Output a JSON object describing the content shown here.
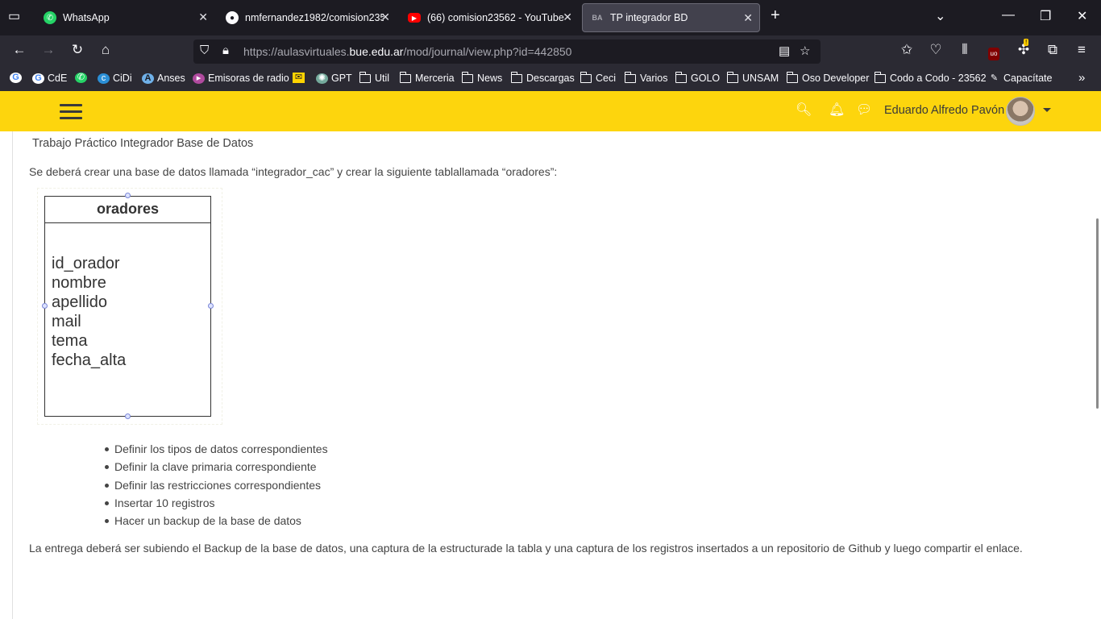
{
  "browser": {
    "tabs": [
      {
        "title": "WhatsApp",
        "icon": "whatsapp-icon"
      },
      {
        "title": "nmfernandez1982/comision235",
        "icon": "github-icon"
      },
      {
        "title": "(66) comision23562 - YouTube",
        "icon": "youtube-icon"
      },
      {
        "title": "TP integrador BD",
        "icon": "ba-icon"
      }
    ],
    "url_prefix": "https://aulasvirtuales.",
    "url_domain": "bue.edu.ar",
    "url_path": "/mod/journal/view.php?id=442850",
    "bookmarks": [
      "CdE",
      "CiDi",
      "Anses",
      "Emisoras de radio",
      "GPT",
      "Util",
      "Merceria",
      "News",
      "Descargas",
      "Ceci",
      "Varios",
      "GOLO",
      "UNSAM",
      "Oso Developer",
      "Codo a Codo - 23562",
      "Capacítate"
    ],
    "extension_badge": "!"
  },
  "header": {
    "user_name": "Eduardo Alfredo Pavón",
    "accent_color": "#fdd50d"
  },
  "page": {
    "heading": "Trabajo Práctico Integrador Base de Datos",
    "intro": "Se deberá crear una base de datos llamada “integrador_cac” y crear la siguiente tablallamada “oradores”:",
    "entity": {
      "name": "oradores",
      "fields": [
        "id_orador",
        "nombre",
        "apellido",
        "mail",
        "tema",
        "fecha_alta"
      ]
    },
    "tasks": [
      "Definir los tipos de datos correspondientes",
      "Definir la clave primaria correspondiente",
      "Definir las restricciones correspondientes",
      "Insertar 10 registros",
      "Hacer un backup de la base de datos"
    ],
    "closing": "La entrega deberá ser subiendo el Backup de la base de datos, una captura de la estructurade la tabla y una captura de los registros insertados a un repositorio de Github y luego compartir el enlace."
  }
}
